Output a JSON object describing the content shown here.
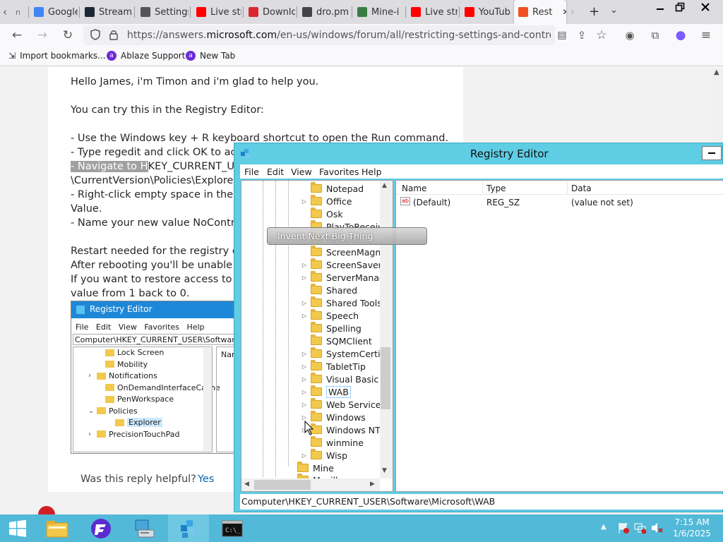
{
  "browser": {
    "tabs": [
      {
        "label": "Google",
        "icon": "google-icon",
        "color": "#4285f4"
      },
      {
        "label": "Stream",
        "icon": "steam-icon",
        "color": "#1b2838"
      },
      {
        "label": "Settings",
        "icon": "gear-icon",
        "color": "#555555"
      },
      {
        "label": "Live str",
        "icon": "youtube-icon",
        "color": "#ff0000"
      },
      {
        "label": "Downlo",
        "icon": "mega-icon",
        "color": "#d9272e"
      },
      {
        "label": "dro.pm",
        "icon": "page-icon",
        "color": "#444444"
      },
      {
        "label": "Mine-i",
        "icon": "cube-icon",
        "color": "#3a7d44"
      },
      {
        "label": "Live str",
        "icon": "youtube-icon",
        "color": "#ff0000"
      },
      {
        "label": "YouTub",
        "icon": "youtube-icon",
        "color": "#ff0000"
      },
      {
        "label": "Rest",
        "icon": "microsoft-icon",
        "color": "#f25022"
      }
    ],
    "url_prefix": "https://answers.",
    "url_domain": "microsoft.com",
    "url_rest": "/en-us/windows/forum/all/restricting-settings-and-control-panel-fo",
    "bookmarks": [
      {
        "label": "Import bookmarks..."
      },
      {
        "label": "Ablaze Support"
      },
      {
        "label": "New Tab"
      }
    ]
  },
  "post": {
    "lines": [
      "Hello James, i'm Timon and i'm glad to help you.",
      "You can try this in the Registry Editor:",
      "- Use the Windows key + R keyboard shortcut to open the Run command.",
      "- Type regedit and click OK to acce",
      "KEY_CURRENT_USE",
      "\\CurrentVersion\\Policies\\Explorer fr",
      "- Right-click empty space in the rig",
      "Value.",
      "- Name your new value NoControlP",
      "Restart needed for the registry chan",
      "After rebooting you'll be unable to",
      "If you want to restore access to Co",
      "value from 1 back to 0."
    ],
    "highlight": "- Navigate to H",
    "helpful_label": "Was this reply helpful?",
    "yes_label": "Yes"
  },
  "embedded": {
    "title": "Registry Editor",
    "menu": [
      "File",
      "Edit",
      "View",
      "Favorites",
      "Help"
    ],
    "path": "Computer\\HKEY_CURRENT_USER\\Software\\Mi",
    "items": [
      "Lock Screen",
      "Mobility",
      "Notifications",
      "OnDemandInterfaceCache",
      "PenWorkspace",
      "Policies",
      "Explorer",
      "PrecisionTouchPad"
    ],
    "col": "Nar"
  },
  "regedit": {
    "title": "Registry Editor",
    "menu": [
      "File",
      "Edit",
      "View",
      "Favorites",
      "Help"
    ],
    "tree": [
      {
        "label": "Notepad",
        "exp": ""
      },
      {
        "label": "Office",
        "exp": "▷"
      },
      {
        "label": "Osk",
        "exp": ""
      },
      {
        "label": "PlayToReceive",
        "exp": ""
      },
      {
        "label": "Remote...",
        "exp": "▷"
      },
      {
        "label": "ScreenMagnifi",
        "exp": ""
      },
      {
        "label": "ScreenSavers",
        "exp": "▷"
      },
      {
        "label": "ServerManage",
        "exp": "▷"
      },
      {
        "label": "Shared",
        "exp": ""
      },
      {
        "label": "Shared Tools",
        "exp": "▷"
      },
      {
        "label": "Speech",
        "exp": "▷"
      },
      {
        "label": "Spelling",
        "exp": ""
      },
      {
        "label": "SQMClient",
        "exp": ""
      },
      {
        "label": "SystemCertific",
        "exp": "▷"
      },
      {
        "label": "TabletTip",
        "exp": "▷"
      },
      {
        "label": "Visual Basic",
        "exp": "▷"
      },
      {
        "label": "WAB",
        "exp": "▷"
      },
      {
        "label": "Web Service Pr",
        "exp": "▷"
      },
      {
        "label": "Windows",
        "exp": "▷"
      },
      {
        "label": "Windows NT",
        "exp": "▷"
      },
      {
        "label": "winmine",
        "exp": ""
      },
      {
        "label": "Wisp",
        "exp": "▷"
      }
    ],
    "tree_parent": [
      {
        "label": "Mine",
        "exp": ""
      },
      {
        "label": "Mozilla",
        "exp": "▷"
      }
    ],
    "columns": [
      "Name",
      "Type",
      "Data"
    ],
    "values": [
      {
        "name": "(Default)",
        "type": "REG_SZ",
        "data": "(value not set)"
      }
    ],
    "status": "Computer\\HKEY_CURRENT_USER\\Software\\Microsoft\\WAB"
  },
  "tooltip": "Invent Next Big Thing",
  "taskbar": {
    "time": "7:15 AM",
    "date": "1/6/2025"
  }
}
